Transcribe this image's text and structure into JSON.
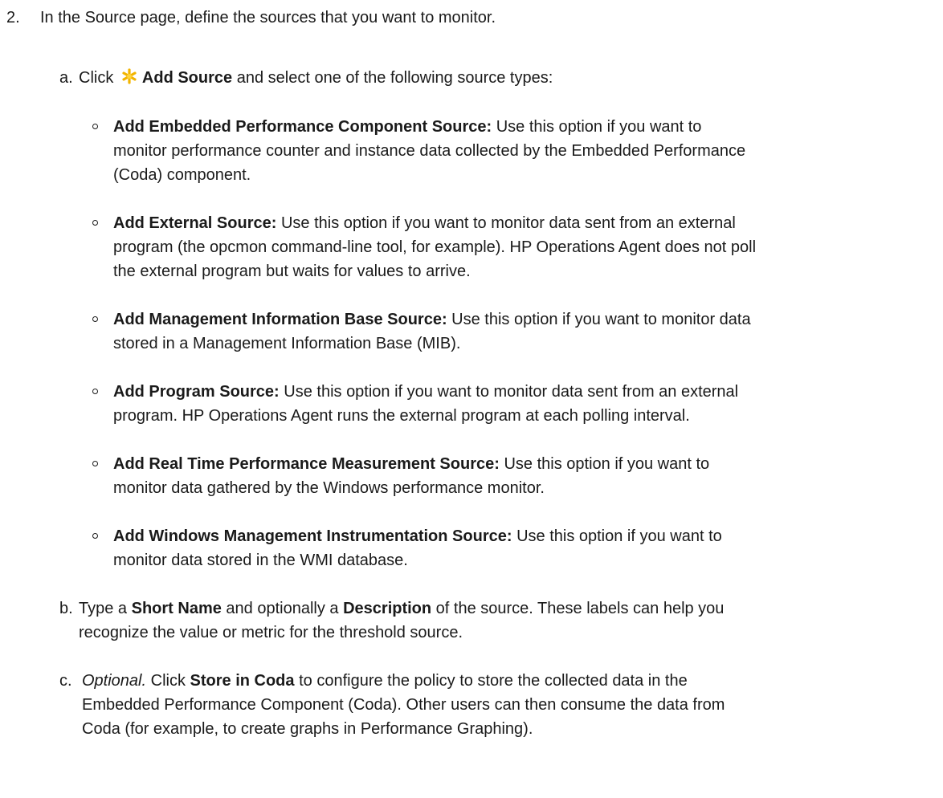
{
  "step2": {
    "number": "2.",
    "text": "In the Source page, define the sources that you want to monitor."
  },
  "substep_a": {
    "marker": "a.",
    "click": "Click",
    "button_label": "Add Source",
    "rest": "and select one of the following source types:",
    "icon": "star-icon"
  },
  "source_types": [
    {
      "title": "Add Embedded Performance Component Source:",
      "description_lines": [
        " Use this option if you want to",
        "monitor performance counter and instance data collected by the Embedded Performance",
        "(Coda) component."
      ]
    },
    {
      "title": "Add External Source:",
      "description_lines": [
        " Use this option if you want to monitor data sent from an external",
        "program (the opcmon command-line tool, for example). HP Operations Agent does not poll",
        "the external program but waits for values to arrive."
      ]
    },
    {
      "title": "Add Management Information Base Source:",
      "description_lines": [
        " Use this option if you want to monitor data",
        "stored in a Management Information Base (MIB)."
      ]
    },
    {
      "title": "Add Program Source:",
      "description_lines": [
        " Use this option if you want to monitor data sent from an external",
        "program. HP Operations Agent runs the external program at each polling interval."
      ]
    },
    {
      "title": "Add Real Time Performance Measurement Source:",
      "description_lines": [
        " Use this option if you want to",
        "monitor data gathered by the Windows performance monitor."
      ]
    },
    {
      "title": "Add Windows Management Instrumentation Source:",
      "description_lines": [
        " Use this option if you want to",
        "monitor data stored in the WMI database."
      ]
    }
  ],
  "substep_b": {
    "marker": "b.",
    "t1": "Type a ",
    "short_name": "Short Name",
    "t2": " and optionally a ",
    "description": "Description",
    "t3": " of the source. These labels can help you",
    "line2": "recognize the value or metric for the threshold source."
  },
  "substep_c": {
    "marker": "c.",
    "optional": "Optional.",
    "t1": " Click ",
    "store": "Store in Coda",
    "t2": " to configure the policy to store the collected data in the",
    "line2": "Embedded Performance Component (Coda). Other users can then consume the data from",
    "line3": "Coda (for example, to create graphs in Performance Graphing)."
  }
}
